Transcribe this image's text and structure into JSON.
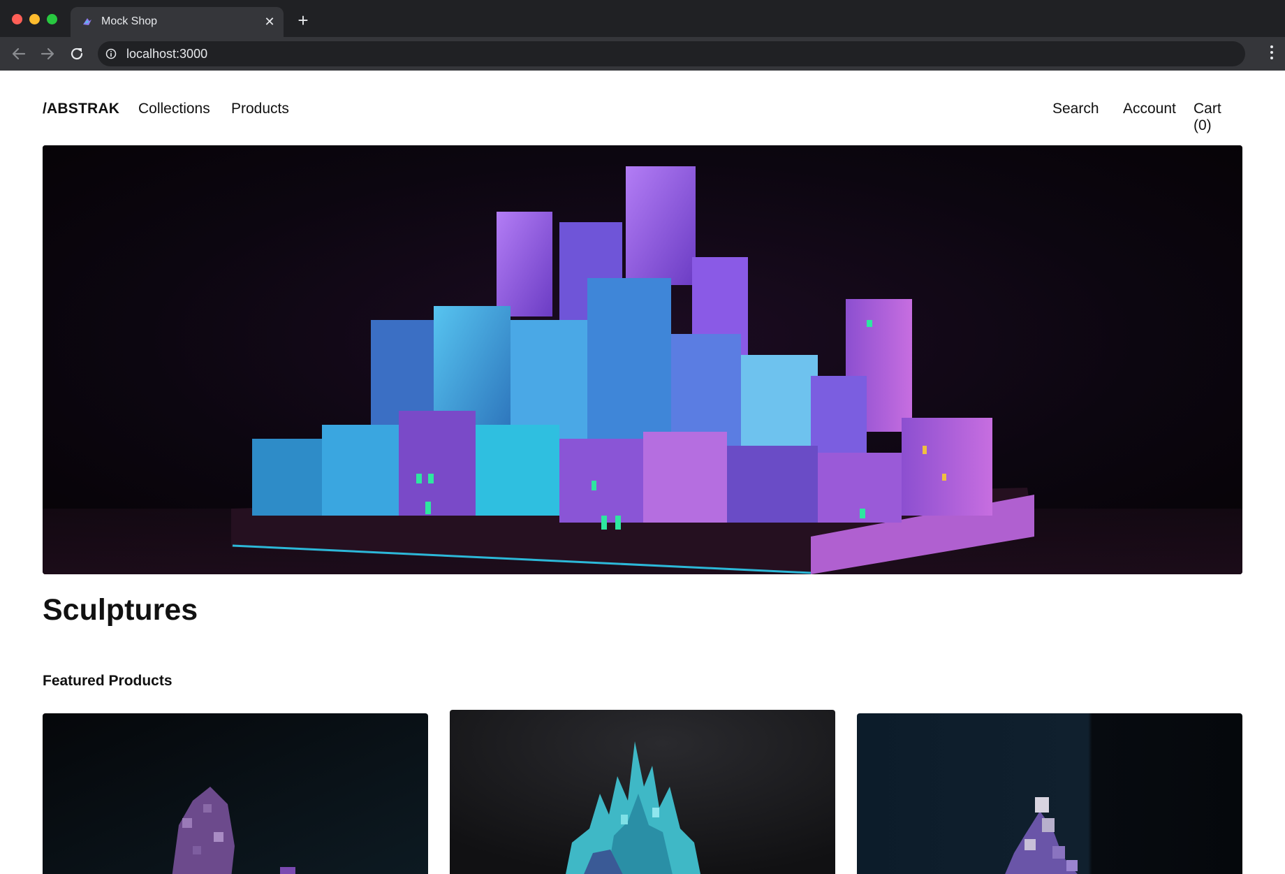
{
  "browser": {
    "tab_title": "Mock Shop",
    "url": "localhost:3000",
    "new_tab_symbol": "+",
    "close_symbol": "✕"
  },
  "site": {
    "logo": "/ABSTRAK",
    "nav_left": [
      {
        "label": "Collections"
      },
      {
        "label": "Products"
      }
    ],
    "nav_right": [
      {
        "label": "Search"
      },
      {
        "label": "Account"
      },
      {
        "label": "Cart (0)"
      }
    ]
  },
  "hero": {
    "image": "voxel-city-sculpture",
    "accent_colors": [
      "#9b5cf0",
      "#3aa6e0",
      "#c06ad8",
      "#2ee6a0"
    ]
  },
  "collection": {
    "title": "Sculptures",
    "featured_heading": "Featured Products"
  },
  "featured_products": [
    {
      "image": "purple-voxel-sculpture"
    },
    {
      "image": "teal-crystal-voxel-sculpture"
    },
    {
      "image": "lilac-tower-voxel-sculpture"
    }
  ]
}
